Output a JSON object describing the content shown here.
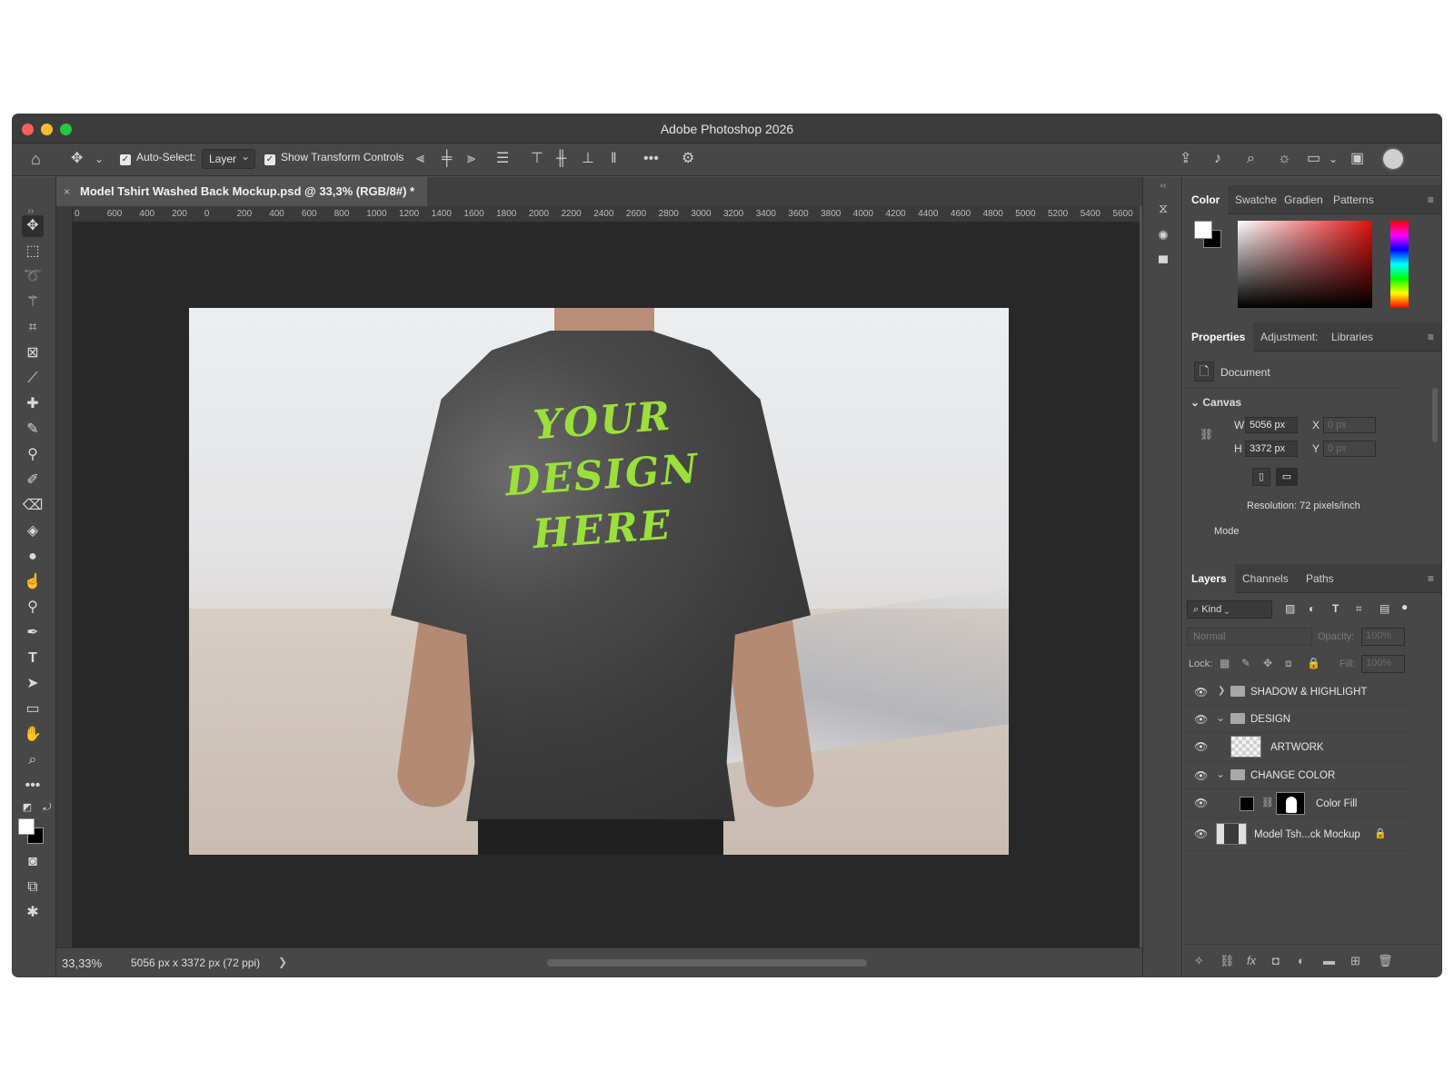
{
  "app": {
    "title": "Adobe Photoshop 2026"
  },
  "options_bar": {
    "auto_select_label": "Auto-Select:",
    "auto_select_value": "Layer",
    "show_transform_label": "Show Transform Controls",
    "more_label": "•••"
  },
  "document": {
    "tab_title": "Model Tshirt Washed Back Mockup.psd @ 33,3% (RGB/8#) *",
    "close_label": "×",
    "artwork_lines": [
      "YOUR",
      "DESIGN",
      "HERE"
    ]
  },
  "ruler": {
    "h_ticks": [
      "0",
      "600",
      "400",
      "200",
      "0",
      "200",
      "400",
      "600",
      "800",
      "1000",
      "1200",
      "1400",
      "1600",
      "1800",
      "2000",
      "2200",
      "2400",
      "2600",
      "2800",
      "3000",
      "3200",
      "3400",
      "3600",
      "3800",
      "4000",
      "4200",
      "4400",
      "4600",
      "4800",
      "5000",
      "5200",
      "5400",
      "5600"
    ]
  },
  "status": {
    "zoom": "33,33%",
    "dimensions": "5056 px x 3372 px (72 ppi)",
    "arrow": "❯"
  },
  "color_panel": {
    "tabs": [
      "Color",
      "Swatche",
      "Gradien",
      "Patterns"
    ]
  },
  "properties_panel": {
    "tabs": [
      "Properties",
      "Adjustment:",
      "Libraries"
    ],
    "doc_label": "Document",
    "canvas_label": "Canvas",
    "w_label": "W",
    "w_value": "5056 px",
    "h_label": "H",
    "h_value": "3372 px",
    "x_label": "X",
    "x_value": "0 px",
    "y_label": "Y",
    "y_value": "0 px",
    "resolution": "Resolution: 72 pixels/inch",
    "mode_label": "Mode"
  },
  "layers_panel": {
    "tabs": [
      "Layers",
      "Channels",
      "Paths"
    ],
    "kind_label": "Kind",
    "blend_mode": "Normal",
    "opacity_label": "Opacity:",
    "opacity_value": "100%",
    "lock_label": "Lock:",
    "fill_label": "Fill:",
    "fill_value": "100%",
    "layers": [
      {
        "name": "SHADOW & HIGHLIGHT",
        "type": "group"
      },
      {
        "name": "DESIGN",
        "type": "group"
      },
      {
        "name": "ARTWORK",
        "type": "smart-object"
      },
      {
        "name": "CHANGE COLOR",
        "type": "group"
      },
      {
        "name": "Color Fill",
        "type": "fill"
      },
      {
        "name": "Model Tsh...ck Mockup",
        "type": "locked-image"
      }
    ]
  },
  "colors": {
    "accent_green": "#9be03a"
  }
}
